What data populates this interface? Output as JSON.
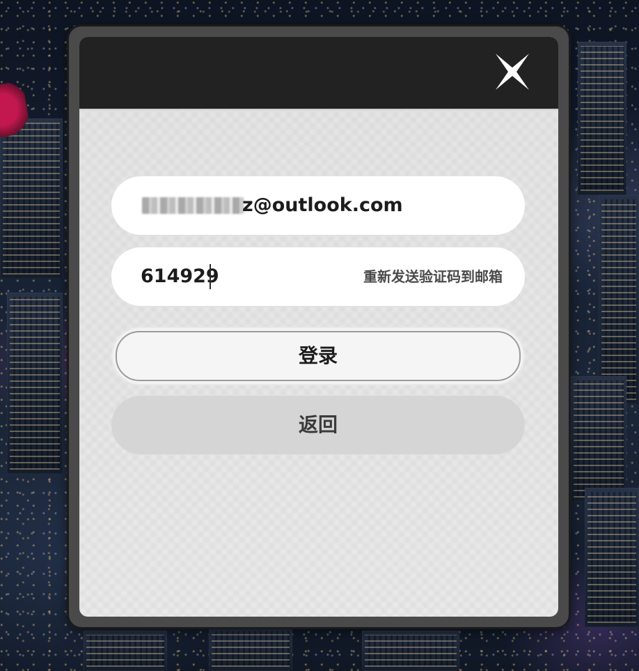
{
  "login_dialog": {
    "email_visible_text": "z@outlook.com",
    "verification_code": "614929",
    "resend_link_label": "重新发送验证码到邮箱",
    "login_button_label": "登录",
    "back_button_label": "返回"
  },
  "colors": {
    "header": "#222222",
    "dialog_body": "#e4e4e4",
    "input_bg": "#ffffff",
    "login_button_bg": "#f5f5f5",
    "back_button_bg": "#d5d5d5"
  },
  "icons": {
    "close": "close-icon"
  }
}
